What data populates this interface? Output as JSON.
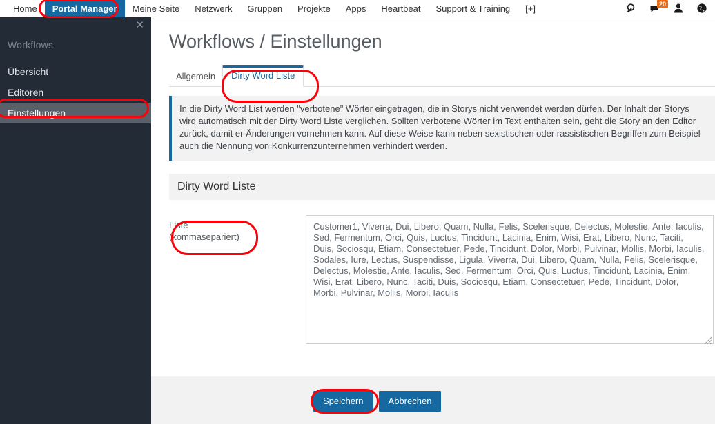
{
  "topnav": {
    "items": [
      {
        "label": "Home",
        "active": false
      },
      {
        "label": "Portal Manager",
        "active": true
      },
      {
        "label": "Meine Seite",
        "active": false
      },
      {
        "label": "Netzwerk",
        "active": false
      },
      {
        "label": "Gruppen",
        "active": false
      },
      {
        "label": "Projekte",
        "active": false
      },
      {
        "label": "Apps",
        "active": false
      },
      {
        "label": "Heartbeat",
        "active": false
      },
      {
        "label": "Support & Training",
        "active": false
      },
      {
        "label": "[+]",
        "active": false
      }
    ],
    "icons": [
      "search-icon",
      "messages-icon",
      "user-icon",
      "globe-icon"
    ],
    "message_badge": "20",
    "badge_color": "#ef6c12",
    "active_color": "#1668a0"
  },
  "sidebar": {
    "close_label": "✕",
    "title": "Workflows",
    "items": [
      {
        "label": "Übersicht",
        "active": false
      },
      {
        "label": "Editoren",
        "active": false
      },
      {
        "label": "Einstellungen",
        "active": true
      }
    ],
    "background": "#222b36",
    "active_background": "#5a6069"
  },
  "main": {
    "page_title": "Workflows / Einstellungen",
    "tabs": [
      {
        "label": "Allgemein",
        "active": false
      },
      {
        "label": "Dirty Word Liste",
        "active": true
      }
    ],
    "info_text": "In die Dirty Word List werden \"verbotene\" Wörter eingetragen, die in Storys nicht verwendet werden dürfen. Der Inhalt der Storys wird automatisch mit der Dirty Word Liste verglichen. Sollten verbotene Wörter im Text enthalten sein, geht die Story an den Editor zurück, damit er Änderungen vornehmen kann. Auf diese Weise kann neben sexistischen oder rassistischen Begriffen zum Beispiel auch die Nennung von Konkurrenzunternehmen verhindert werden.",
    "info_accent_color": "#1668a0",
    "section_header": "Dirty Word Liste",
    "field_label_line1": "Liste",
    "field_label_line2": "(kommasepariert)",
    "textarea_value": "Customer1, Viverra, Dui, Libero, Quam, Nulla, Felis, Scelerisque, Delectus, Molestie, Ante, Iaculis, Sed, Fermentum, Orci, Quis, Luctus, Tincidunt, Lacinia, Enim, Wisi, Erat, Libero, Nunc, Taciti, Duis, Sociosqu, Etiam, Consectetuer, Pede, Tincidunt, Dolor, Morbi, Pulvinar, Mollis, Morbi, Iaculis, Sodales, Iure, Lectus, Suspendisse, Ligula, Viverra, Dui, Libero, Quam, Nulla, Felis, Scelerisque, Delectus, Molestie, Ante, Iaculis, Sed, Fermentum, Orci, Quis, Luctus, Tincidunt, Lacinia, Enim, Wisi, Erat, Libero, Nunc, Taciti, Duis, Sociosqu, Etiam, Consectetuer, Pede, Tincidunt, Dolor, Morbi, Pulvinar, Mollis, Morbi, Iaculis",
    "textarea_placeholder": "",
    "save_label": "Speichern",
    "cancel_label": "Abbrechen",
    "button_color": "#1668a0"
  },
  "annotations": {
    "color": "#fd0009",
    "targets": [
      "portal-manager-nav",
      "einstellungen-sidebar-item",
      "dirty-word-liste-tab",
      "liste-field-label",
      "speichern-button"
    ]
  }
}
